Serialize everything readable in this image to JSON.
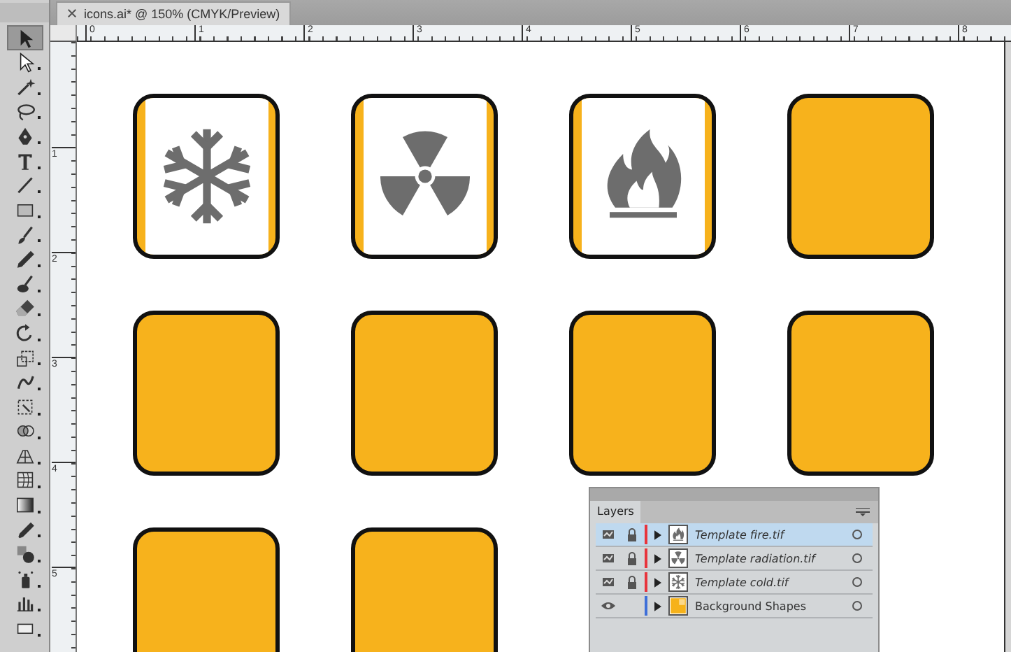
{
  "document_tab": {
    "title": "icons.ai* @ 150% (CMYK/Preview)"
  },
  "tools": [
    {
      "kind": "selection",
      "selected": true
    },
    {
      "kind": "direct-selection",
      "selected": false
    },
    {
      "kind": "magic-wand",
      "selected": false
    },
    {
      "kind": "lasso",
      "selected": false
    },
    {
      "kind": "pen",
      "selected": false
    },
    {
      "kind": "type",
      "selected": false
    },
    {
      "kind": "line",
      "selected": false
    },
    {
      "kind": "rectangle",
      "selected": false
    },
    {
      "kind": "paintbrush",
      "selected": false
    },
    {
      "kind": "pencil",
      "selected": false
    },
    {
      "kind": "blob-brush",
      "selected": false
    },
    {
      "kind": "eraser",
      "selected": false
    },
    {
      "kind": "rotate",
      "selected": false
    },
    {
      "kind": "scale",
      "selected": false
    },
    {
      "kind": "warp",
      "selected": false
    },
    {
      "kind": "free-transform",
      "selected": false
    },
    {
      "kind": "shape-builder",
      "selected": false
    },
    {
      "kind": "perspective",
      "selected": false
    },
    {
      "kind": "mesh",
      "selected": false
    },
    {
      "kind": "gradient",
      "selected": false
    },
    {
      "kind": "eyedropper",
      "selected": false
    },
    {
      "kind": "blend",
      "selected": false
    },
    {
      "kind": "symbol-sprayer",
      "selected": false
    },
    {
      "kind": "graph",
      "selected": false
    },
    {
      "kind": "artboard",
      "selected": false
    }
  ],
  "ruler_horizontal": [
    "0",
    "1",
    "2",
    "3",
    "4",
    "5",
    "6",
    "7",
    "8"
  ],
  "ruler_vertical": [
    "1",
    "2",
    "3",
    "4",
    "5"
  ],
  "tiles": [
    {
      "kind": "snowflake"
    },
    {
      "kind": "radiation"
    },
    {
      "kind": "fire"
    },
    {
      "kind": "blank"
    },
    {
      "kind": "blank"
    },
    {
      "kind": "blank"
    },
    {
      "kind": "blank"
    },
    {
      "kind": "blank"
    },
    {
      "kind": "blank"
    },
    {
      "kind": "blank"
    }
  ],
  "layers_panel": {
    "tab": "Layers",
    "layers": [
      {
        "name": "Template fire.tif",
        "kind": "fire",
        "locked": true,
        "color": "#e8343c",
        "selected": true
      },
      {
        "name": "Template radiation.tif",
        "kind": "radiation",
        "locked": true,
        "color": "#e8343c",
        "selected": false
      },
      {
        "name": "Template cold.tif",
        "kind": "snowflake",
        "locked": true,
        "color": "#e8343c",
        "selected": false
      },
      {
        "name": "Background Shapes",
        "kind": "shapes",
        "locked": false,
        "color": "#3e6fd8",
        "selected": false
      }
    ]
  }
}
